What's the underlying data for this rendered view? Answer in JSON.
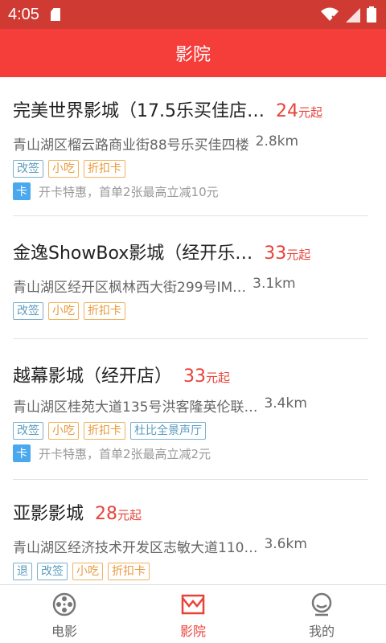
{
  "status": {
    "time": "4:05"
  },
  "header": {
    "title": "影院"
  },
  "cinemas": [
    {
      "name": "完美世界影城（17.5乐买佳店…",
      "price": "24",
      "price_unit": "元起",
      "address": "青山湖区榴云路商业街88号乐买佳四楼",
      "distance": "2.8km",
      "tags": [
        {
          "label": "改签",
          "style": "blue"
        },
        {
          "label": "小吃",
          "style": "orange"
        },
        {
          "label": "折扣卡",
          "style": "orange"
        }
      ],
      "promo_badge": "卡",
      "promo": "开卡特惠，首单2张最高立减10元"
    },
    {
      "name": "金逸ShowBox影城（经开乐…",
      "price": "33",
      "price_unit": "元起",
      "address": "青山湖区经开区枫林西大街299号IM…",
      "distance": "3.1km",
      "tags": [
        {
          "label": "改签",
          "style": "blue"
        },
        {
          "label": "小吃",
          "style": "orange"
        },
        {
          "label": "折扣卡",
          "style": "orange"
        }
      ]
    },
    {
      "name": "越幕影城（经开店）",
      "price": "33",
      "price_unit": "元起",
      "address": "青山湖区桂苑大道135号洪客隆英伦联…",
      "distance": "3.4km",
      "tags": [
        {
          "label": "改签",
          "style": "blue"
        },
        {
          "label": "小吃",
          "style": "orange"
        },
        {
          "label": "折扣卡",
          "style": "orange"
        },
        {
          "label": "杜比全景声厅",
          "style": "blue"
        }
      ],
      "promo_badge": "卡",
      "promo": "开卡特惠，首单2张最高立减2元"
    },
    {
      "name": "亚影影城",
      "price": "28",
      "price_unit": "元起",
      "address": "青山湖区经济技术开发区志敏大道110…",
      "distance": "3.6km",
      "tags": [
        {
          "label": "退",
          "style": "blue"
        },
        {
          "label": "改签",
          "style": "blue"
        },
        {
          "label": "小吃",
          "style": "orange"
        },
        {
          "label": "折扣卡",
          "style": "orange"
        }
      ]
    }
  ],
  "tabbar": {
    "movies": "电影",
    "cinemas": "影院",
    "mine": "我的"
  },
  "colors": {
    "accent": "#f53e3a",
    "price": "#e8433a"
  }
}
